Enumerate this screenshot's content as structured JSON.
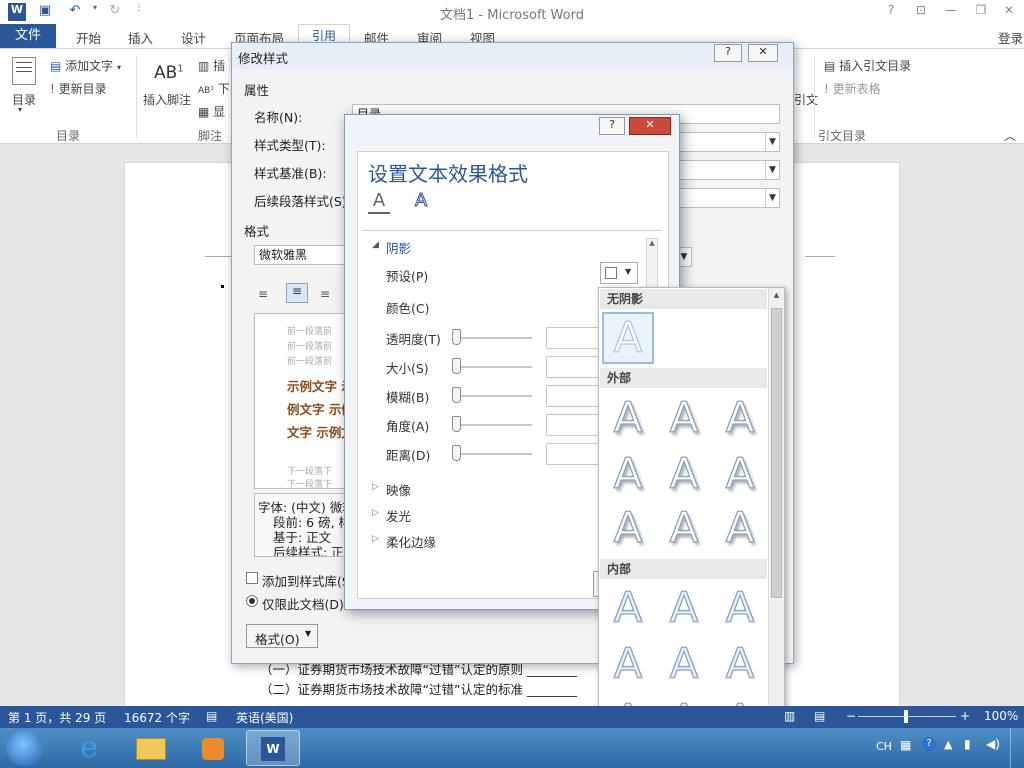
{
  "title_bar": {
    "title": "文档1 - Microsoft Word",
    "help": "?",
    "login": "登录"
  },
  "tabs": [
    "文件",
    "开始",
    "插入",
    "设计",
    "页面布局",
    "引用",
    "邮件",
    "审阅",
    "视图"
  ],
  "ribbon": {
    "toc_label": "目录",
    "add_text": "添加文字",
    "update_toc": "更新目录",
    "insert_footnote": "插入脚注",
    "insert_footnote_short": "插",
    "next_short": "下",
    "show_short": "显",
    "insert_toa": "插入引文目录",
    "update_table": "更新表格",
    "citation_short": "引文",
    "groups": {
      "toc": "目录",
      "footnotes": "脚注",
      "citation": "引文目录"
    }
  },
  "modify_style": {
    "title": "修改样式",
    "properties": "属性",
    "name_label": "名称(N):",
    "name_value": "目录",
    "type_label": "样式类型(T):",
    "based_label": "样式基准(B):",
    "follow_label": "后续段落样式(S):",
    "format_label": "格式",
    "font_value": "微软雅黑",
    "preview_prev": [
      "前一段落前",
      "前一段落前",
      "前一段落前"
    ],
    "preview_samples": [
      "示例文字 示",
      "例文字 示例",
      "文字 示例文"
    ],
    "preview_next": [
      "下一段落下",
      "下一段落下"
    ],
    "desc_lines": [
      "字体: (中文) 微软",
      "段前: 6 磅, 样",
      "基于: 正文",
      "后续样式: 正文"
    ],
    "add_to_gallery": "添加到样式库(S)",
    "only_this_doc": "仅限此文档(D)",
    "format_button": "格式(O)"
  },
  "text_effects": {
    "title": "设置文本效果格式",
    "section_shadow": "阴影",
    "preset": "预设(P)",
    "color": "颜色(C)",
    "transparency": "透明度(T)",
    "size": "大小(S)",
    "blur": "模糊(B)",
    "angle": "角度(A)",
    "distance": "距离(D)",
    "reflection": "映像",
    "glow": "发光",
    "soft_edges": "柔化边缘"
  },
  "shadow_gallery": {
    "none": "无阴影",
    "outer": "外部",
    "inner": "内部",
    "glyph": "A"
  },
  "document": {
    "line1": "（一）证券期货市场技术故障“过错”认定的原则 ________",
    "line2": "（二）证券期货市场技术故障“过错”认定的标准 ________"
  },
  "status": {
    "page": "第 1 页，共 29 页",
    "words": "16672 个字",
    "lang": "英语(美国)",
    "zoom": "100%"
  },
  "taskbar": {
    "ime": "CH"
  }
}
